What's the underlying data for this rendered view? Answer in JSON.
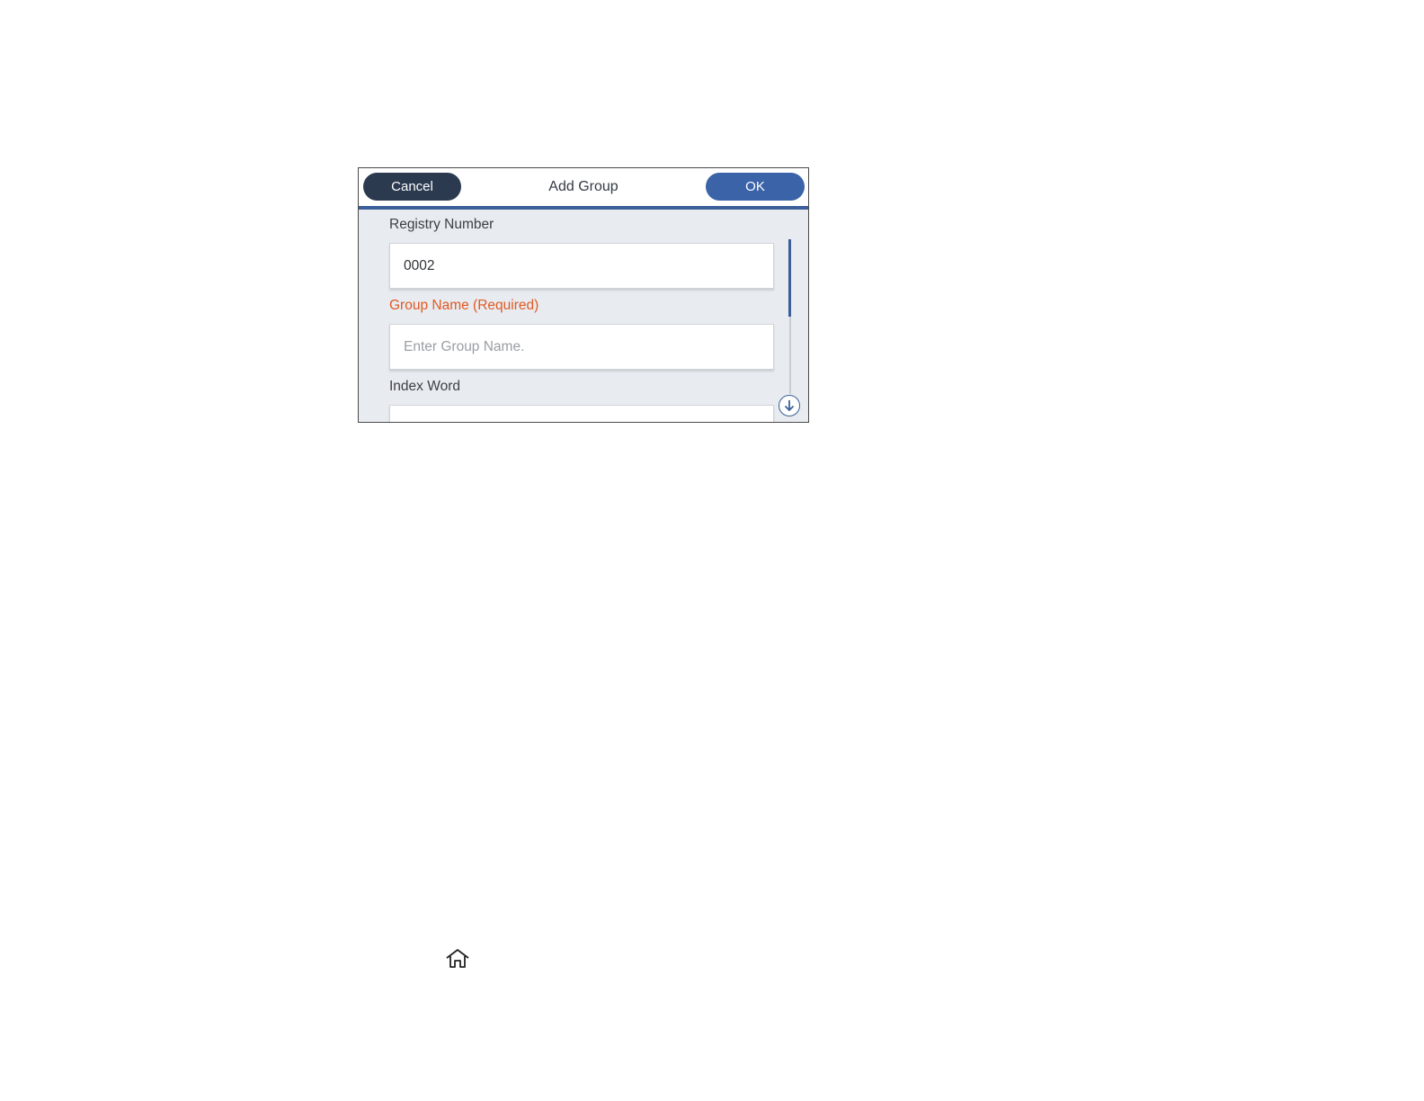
{
  "dialog": {
    "title": "Add Group",
    "cancel_label": "Cancel",
    "ok_label": "OK"
  },
  "form": {
    "registry_number": {
      "label": "Registry Number",
      "value": "0002"
    },
    "group_name": {
      "label": "Group Name (Required)",
      "placeholder": "Enter Group Name."
    },
    "index_word": {
      "label": "Index Word",
      "value": ""
    }
  },
  "colors": {
    "accent": "#3b5f99",
    "cancel_button": "#2b3a4f",
    "ok_button": "#3a63a8",
    "required_label": "#e05a24",
    "background": "#e8ebef"
  },
  "icons": {
    "scroll_down": "arrow-down-circle-icon",
    "home": "home-icon"
  }
}
